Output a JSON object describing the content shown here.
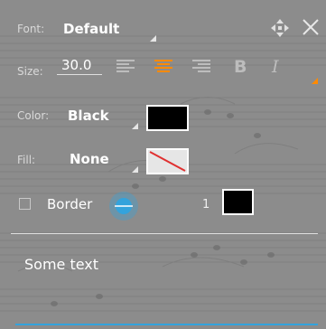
{
  "font": {
    "label": "Font:",
    "value": "Default"
  },
  "size": {
    "label": "Size:",
    "value": "30.0"
  },
  "alignment": {
    "options": [
      "align-left",
      "align-center",
      "align-right"
    ],
    "selected": "align-center"
  },
  "format": {
    "bold": "B",
    "italic": "I"
  },
  "color": {
    "label": "Color:",
    "value": "Black",
    "swatch": "#000000"
  },
  "fill": {
    "label": "Fill:",
    "value": "None",
    "swatch": "none"
  },
  "border": {
    "label": "Border",
    "width": "1",
    "swatch": "#000000",
    "checked": false
  },
  "text_field": {
    "value": "Some text"
  },
  "colors": {
    "accent": "#ff8a00",
    "slider": "#33a3dc",
    "underline": "#33a3dc"
  }
}
